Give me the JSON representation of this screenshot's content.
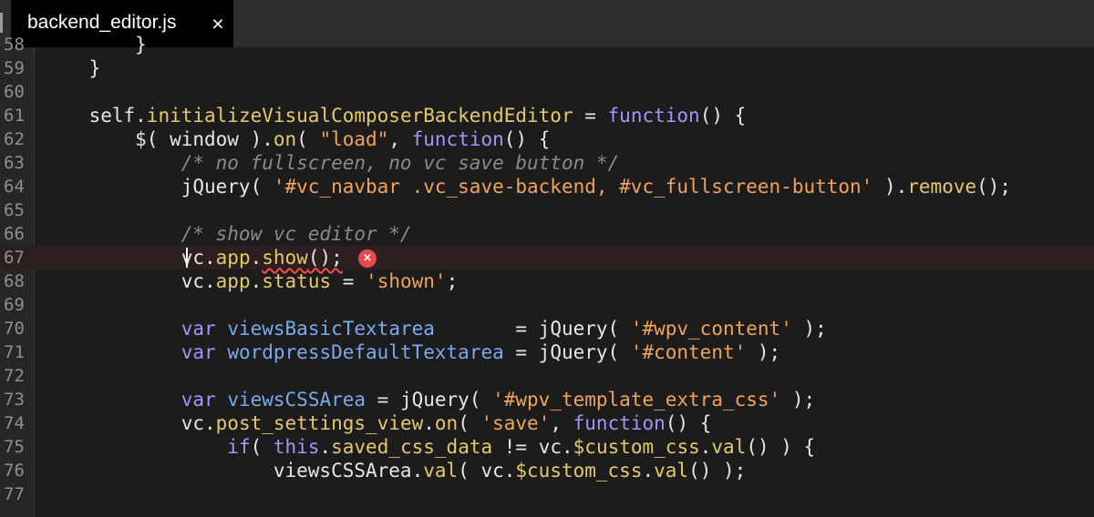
{
  "tab": {
    "title": "backend_editor.js",
    "close_label": "×"
  },
  "editor": {
    "error_icon": "×",
    "lines": [
      {
        "number": "58",
        "tokens": [
          [
            "p",
            "        }"
          ]
        ]
      },
      {
        "number": "59",
        "tokens": [
          [
            "p",
            "    }"
          ]
        ]
      },
      {
        "number": "60",
        "tokens": []
      },
      {
        "number": "61",
        "tokens": [
          [
            "p",
            "    self."
          ],
          [
            "fn",
            "initializeVisualComposerBackendEditor"
          ],
          [
            "p",
            " = "
          ],
          [
            "k",
            "function"
          ],
          [
            "p",
            "() {"
          ]
        ]
      },
      {
        "number": "62",
        "tokens": [
          [
            "p",
            "        $( window )."
          ],
          [
            "fn",
            "on"
          ],
          [
            "p",
            "( "
          ],
          [
            "s",
            "\"load\""
          ],
          [
            "p",
            ", "
          ],
          [
            "k",
            "function"
          ],
          [
            "p",
            "() {"
          ]
        ]
      },
      {
        "number": "63",
        "tokens": [
          [
            "c",
            "            /* no fullscreen, no vc save button */"
          ]
        ]
      },
      {
        "number": "64",
        "tokens": [
          [
            "p",
            "            jQuery( "
          ],
          [
            "s",
            "'#vc_navbar .vc_save-backend, #vc_fullscreen-button'"
          ],
          [
            "p",
            " )."
          ],
          [
            "fn",
            "remove"
          ],
          [
            "p",
            "();"
          ]
        ]
      },
      {
        "number": "65",
        "tokens": []
      },
      {
        "number": "66",
        "tokens": [
          [
            "c",
            "            /* show vc editor */"
          ]
        ]
      },
      {
        "number": "67",
        "tokens": [
          [
            "p",
            "            vc."
          ],
          [
            "fn",
            "app"
          ],
          [
            "p",
            "."
          ],
          [
            "fn",
            "show"
          ],
          [
            "p",
            "();"
          ]
        ]
      },
      {
        "number": "68",
        "tokens": [
          [
            "p",
            "            vc."
          ],
          [
            "fn",
            "app"
          ],
          [
            "p",
            "."
          ],
          [
            "fn",
            "status"
          ],
          [
            "p",
            " = "
          ],
          [
            "s",
            "'shown'"
          ],
          [
            "p",
            ";"
          ]
        ]
      },
      {
        "number": "69",
        "tokens": []
      },
      {
        "number": "70",
        "tokens": [
          [
            "p",
            "            "
          ],
          [
            "k",
            "var"
          ],
          [
            "p",
            " "
          ],
          [
            "v",
            "viewsBasicTextarea"
          ],
          [
            "p",
            "       = jQuery( "
          ],
          [
            "s",
            "'#wpv_content'"
          ],
          [
            "p",
            " );"
          ]
        ]
      },
      {
        "number": "71",
        "tokens": [
          [
            "p",
            "            "
          ],
          [
            "k",
            "var"
          ],
          [
            "p",
            " "
          ],
          [
            "v",
            "wordpressDefaultTextarea"
          ],
          [
            "p",
            " = jQuery( "
          ],
          [
            "s",
            "'#content'"
          ],
          [
            "p",
            " );"
          ]
        ]
      },
      {
        "number": "72",
        "tokens": []
      },
      {
        "number": "73",
        "tokens": [
          [
            "p",
            "            "
          ],
          [
            "k",
            "var"
          ],
          [
            "p",
            " "
          ],
          [
            "v",
            "viewsCSSArea"
          ],
          [
            "p",
            " = jQuery( "
          ],
          [
            "s",
            "'#wpv_template_extra_css'"
          ],
          [
            "p",
            " );"
          ]
        ]
      },
      {
        "number": "74",
        "tokens": [
          [
            "p",
            "            vc."
          ],
          [
            "fn",
            "post_settings_view"
          ],
          [
            "p",
            "."
          ],
          [
            "fn",
            "on"
          ],
          [
            "p",
            "( "
          ],
          [
            "s",
            "'save'"
          ],
          [
            "p",
            ", "
          ],
          [
            "k",
            "function"
          ],
          [
            "p",
            "() {"
          ]
        ]
      },
      {
        "number": "75",
        "tokens": [
          [
            "p",
            "                "
          ],
          [
            "k",
            "if"
          ],
          [
            "p",
            "( "
          ],
          [
            "k",
            "this"
          ],
          [
            "p",
            "."
          ],
          [
            "fn",
            "saved_css_data"
          ],
          [
            "p",
            " != vc."
          ],
          [
            "fn",
            "$custom_css"
          ],
          [
            "p",
            "."
          ],
          [
            "fn",
            "val"
          ],
          [
            "p",
            "() ) {"
          ]
        ]
      },
      {
        "number": "76",
        "tokens": [
          [
            "p",
            "                    viewsCSSArea."
          ],
          [
            "fn",
            "val"
          ],
          [
            "p",
            "( vc."
          ],
          [
            "fn",
            "$custom_css"
          ],
          [
            "p",
            "."
          ],
          [
            "fn",
            "val"
          ],
          [
            "p",
            "() );"
          ]
        ]
      },
      {
        "number": "77",
        "tokens": []
      }
    ]
  }
}
